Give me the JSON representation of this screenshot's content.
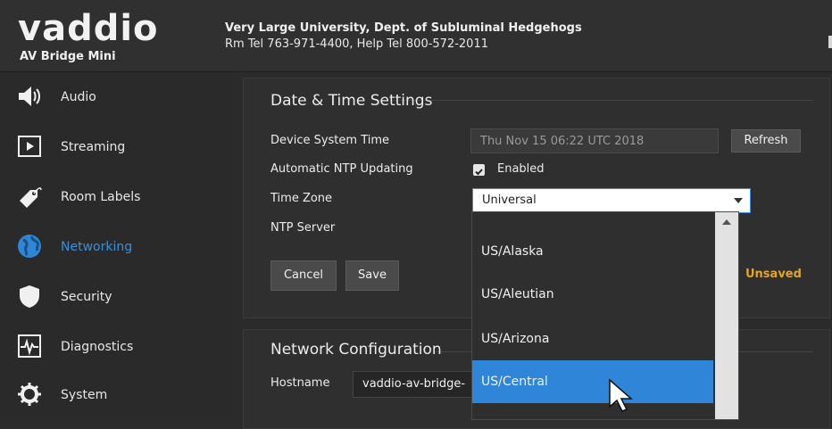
{
  "header": {
    "logo": "vaddio",
    "product": "AV Bridge Mini",
    "organization": "Very Large University, Dept. of Subluminal Hedgehogs",
    "phones": "Rm Tel 763-971-4400, Help Tel 800-572-2011"
  },
  "sidebar": {
    "items": [
      {
        "label": "Audio",
        "icon": "speaker-icon",
        "active": false
      },
      {
        "label": "Streaming",
        "icon": "play-icon",
        "active": false
      },
      {
        "label": "Room Labels",
        "icon": "tag-icon",
        "active": false
      },
      {
        "label": "Networking",
        "icon": "globe-icon",
        "active": true
      },
      {
        "label": "Security",
        "icon": "shield-icon",
        "active": false
      },
      {
        "label": "Diagnostics",
        "icon": "pulse-icon",
        "active": false
      },
      {
        "label": "System",
        "icon": "gear-icon",
        "active": false
      }
    ]
  },
  "datetime": {
    "title": "Date & Time Settings",
    "system_time_label": "Device System Time",
    "system_time_value": "Thu Nov 15 06:22 UTC 2018",
    "refresh_label": "Refresh",
    "ntp_label": "Automatic NTP Updating",
    "ntp_enabled_label": "Enabled",
    "timezone_label": "Time Zone",
    "timezone_value": "Universal",
    "ntp_server_label": "NTP Server",
    "cancel_label": "Cancel",
    "save_label": "Save",
    "status": "Unsaved"
  },
  "timezone_options": [
    "US/Alaska",
    "US/Aleutian",
    "US/Arizona",
    "US/Central"
  ],
  "timezone_highlighted": "US/Central",
  "network": {
    "title": "Network Configuration",
    "hostname_label": "Hostname",
    "hostname_value": "vaddio-av-bridge-"
  },
  "colors": {
    "accent": "#2f86d8",
    "unsaved": "#e0a52a",
    "background": "#2b2b2b"
  }
}
